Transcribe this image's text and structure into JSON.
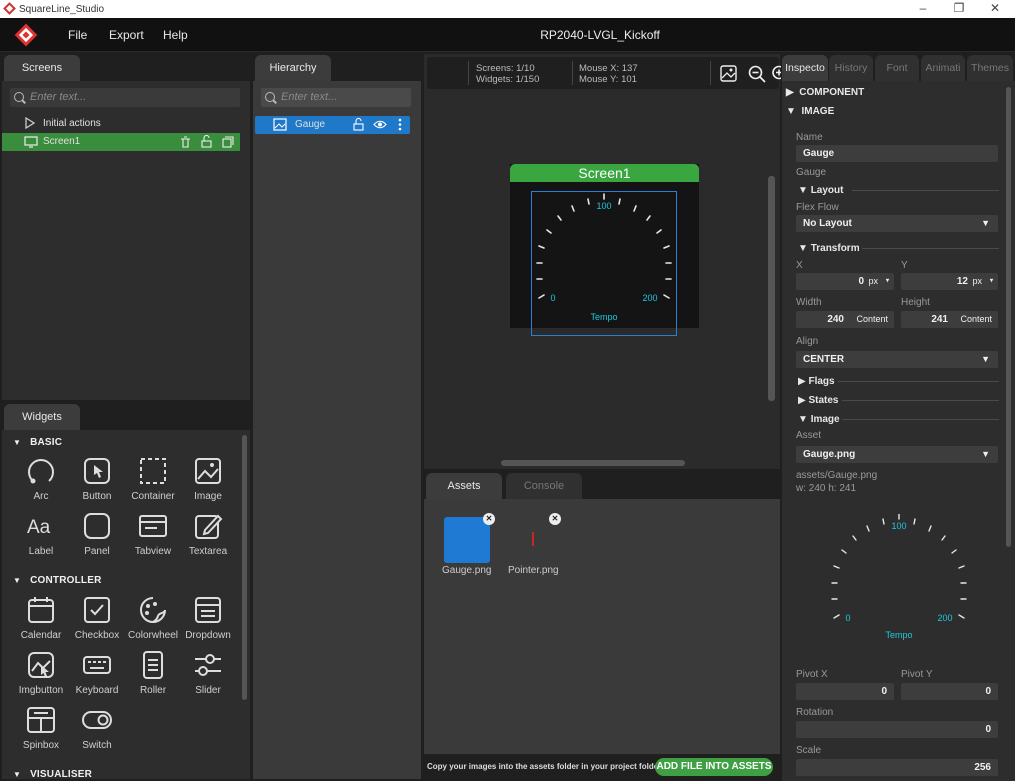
{
  "window": {
    "title": "SquareLine_Studio",
    "minimize": "–",
    "maximize": "❐",
    "close": "✕"
  },
  "menu": {
    "file": "File",
    "export": "Export",
    "help": "Help",
    "project_title": "RP2040-LVGL_Kickoff"
  },
  "screens_panel": {
    "tab": "Screens",
    "search_placeholder": "Enter text...",
    "items": [
      {
        "label": "Initial actions"
      },
      {
        "label": "Screen1"
      }
    ]
  },
  "hierarchy_panel": {
    "tab": "Hierarchy",
    "search_placeholder": "Enter text...",
    "items": [
      {
        "label": "Gauge"
      }
    ]
  },
  "canvas_toolbar": {
    "screens": "Screens: 1/10",
    "widgets": "Widgets: 1/150",
    "mouse_x": "Mouse X: 137",
    "mouse_y": "Mouse Y: 101"
  },
  "canvas": {
    "screen_title": "Screen1",
    "gauge": {
      "label_100": "100",
      "label_0": "0",
      "label_200": "200",
      "caption": "Tempo"
    }
  },
  "widgets_panel": {
    "tab": "Widgets",
    "sections": {
      "basic": "BASIC",
      "controller": "CONTROLLER",
      "visualiser": "VISUALISER"
    },
    "basic": [
      "Arc",
      "Button",
      "Container",
      "Image",
      "Label",
      "Panel",
      "Tabview",
      "Textarea"
    ],
    "controller": [
      "Calendar",
      "Checkbox",
      "Colorwheel",
      "Dropdown",
      "Imgbutton",
      "Keyboard",
      "Roller",
      "Slider",
      "Spinbox",
      "Switch"
    ]
  },
  "assets_panel": {
    "tabs": [
      "Assets",
      "Console"
    ],
    "items": [
      "Gauge.png",
      "Pointer.png"
    ],
    "hint": "Copy your images into the assets folder in your project folder",
    "add_button": "ADD FILE INTO ASSETS"
  },
  "inspector": {
    "tabs": [
      "Inspecto",
      "History",
      "Font",
      "Animati",
      "Themes"
    ],
    "component": "COMPONENT",
    "image": "IMAGE",
    "name_label": "Name",
    "name_value": "Gauge",
    "type_label": "Gauge",
    "layout": "Layout",
    "flex_flow_label": "Flex Flow",
    "flex_flow_value": "No Layout",
    "transform": "Transform",
    "x_label": "X",
    "x_value": "0",
    "x_unit": "px",
    "y_label": "Y",
    "y_value": "12",
    "y_unit": "px",
    "width_label": "Width",
    "width_value": "240",
    "width_unit": "Content",
    "height_label": "Height",
    "height_value": "241",
    "height_unit": "Content",
    "align_label": "Align",
    "align_value": "CENTER",
    "flags": "Flags",
    "states": "States",
    "image_sec": "Image",
    "asset_label": "Asset",
    "asset_value": "Gauge.png",
    "asset_path": "assets/Gauge.png",
    "asset_dims": "w: 240  h: 241",
    "pivot_x_label": "Pivot X",
    "pivot_x_value": "0",
    "pivot_y_label": "Pivot Y",
    "pivot_y_value": "0",
    "rotation_label": "Rotation",
    "rotation_value": "0",
    "scale_label": "Scale",
    "scale_value": "256"
  },
  "colors": {
    "accent_green": "#3a8d3d",
    "selection_blue": "#1f78c8",
    "gauge_cyan": "#1ec8e0"
  }
}
